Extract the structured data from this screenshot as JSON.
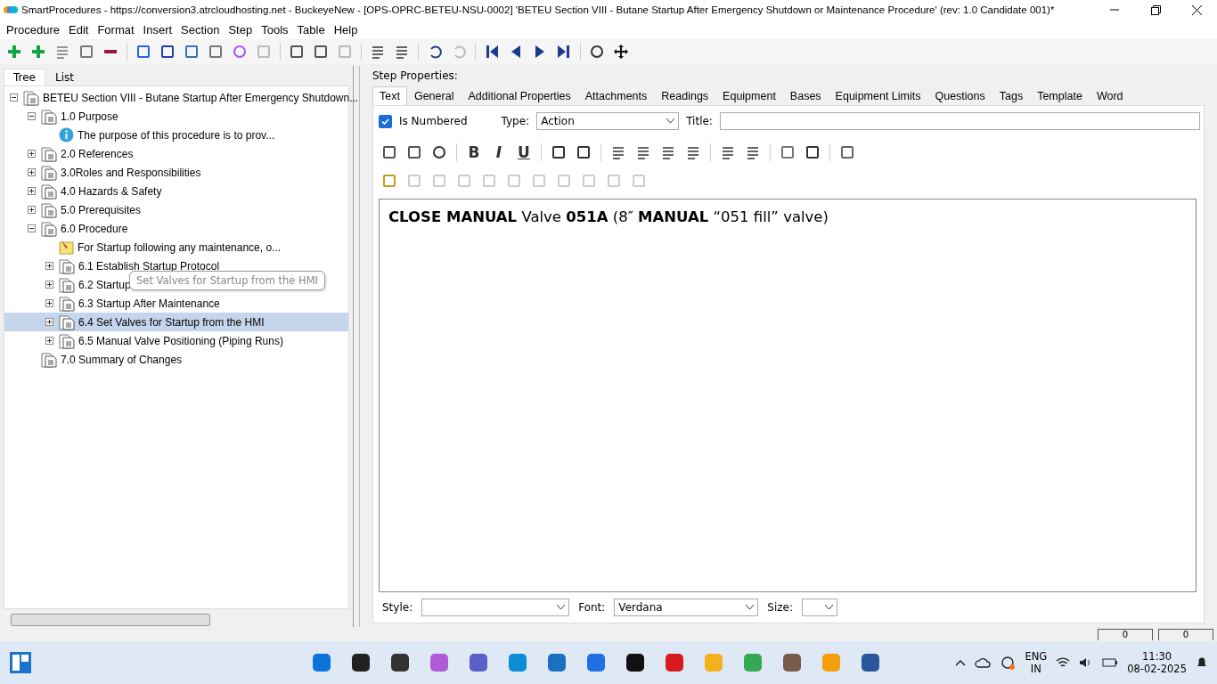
{
  "window": {
    "title": "SmartProcedures - https://conversion3.atrcloudhosting.net - BuckeyeNew - [OPS-OPRC-BETEU-NSU-0002] 'BETEU Section VIII - Butane Startup After Emergency Shutdown or Maintenance Procedure' (rev: 1.0 Candidate 001)*"
  },
  "menu": [
    "Procedure",
    "Edit",
    "Format",
    "Insert",
    "Section",
    "Step",
    "Tools",
    "Table",
    "Help"
  ],
  "left_tabs": [
    {
      "label": "Tree",
      "selected": true
    },
    {
      "label": "List",
      "selected": false
    }
  ],
  "tree": [
    {
      "label": "BETEU Section VIII - Butane Startup After Emergency Shutdown...",
      "kind": "doc",
      "expanded": true,
      "selected": false,
      "children": [
        {
          "label": "1.0 Purpose",
          "kind": "doc",
          "expanded": true,
          "selected": false,
          "children": [
            {
              "label": "The purpose of this procedure is to prov...",
              "kind": "info",
              "selected": false
            }
          ]
        },
        {
          "label": "2.0 References",
          "kind": "doc",
          "expanded": false,
          "selected": false
        },
        {
          "label": "3.0Roles and Responsibilities",
          "kind": "doc",
          "expanded": false,
          "selected": false
        },
        {
          "label": "4.0 Hazards & Safety",
          "kind": "doc",
          "expanded": false,
          "selected": false
        },
        {
          "label": "5.0 Prerequisites",
          "kind": "doc",
          "expanded": false,
          "selected": false
        },
        {
          "label": "6.0 Procedure",
          "kind": "doc",
          "expanded": true,
          "selected": false,
          "children": [
            {
              "label": "For Startup following any maintenance, o...",
              "kind": "note",
              "selected": false
            },
            {
              "label": "6.1 Establish Startup Protocol",
              "kind": "doc",
              "expanded": false,
              "selected": false
            },
            {
              "label": "6.2 Startup",
              "kind": "doc",
              "expanded": false,
              "selected": false
            },
            {
              "label": "6.3 Startup After Maintenance",
              "kind": "doc",
              "expanded": false,
              "selected": false
            },
            {
              "label": "6.4 Set Valves for Startup from the HMI",
              "kind": "doc",
              "expanded": false,
              "selected": true
            },
            {
              "label": "6.5 Manual Valve Positioning (Piping Runs)",
              "kind": "doc",
              "expanded": false,
              "selected": false
            }
          ]
        },
        {
          "label": "7.0 Summary of Changes",
          "kind": "doc",
          "selected": false
        }
      ]
    }
  ],
  "tooltip": "Set Valves for Startup from the HMI",
  "step_properties": {
    "heading": "Step Properties:",
    "tabs": [
      {
        "label": "Text",
        "selected": true
      },
      {
        "label": "General",
        "selected": false
      },
      {
        "label": "Additional Properties",
        "selected": false
      },
      {
        "label": "Attachments",
        "selected": false
      },
      {
        "label": "Readings",
        "selected": false
      },
      {
        "label": "Equipment",
        "selected": false
      },
      {
        "label": "Bases",
        "selected": false
      },
      {
        "label": "Equipment Limits",
        "selected": false
      },
      {
        "label": "Questions",
        "selected": false
      },
      {
        "label": "Tags",
        "selected": false
      },
      {
        "label": "Template",
        "selected": false
      },
      {
        "label": "Word",
        "selected": false
      }
    ],
    "is_numbered": {
      "label": "Is Numbered",
      "checked": true
    },
    "type": {
      "label": "Type:",
      "value": "Action"
    },
    "title": {
      "label": "Title:"
    },
    "format_buttons": [
      "B",
      "I",
      "U"
    ],
    "editor_text": "**CLOSE MANUAL** Valve **051A** (8″ **MANUAL** “051 fill” valve)",
    "style": {
      "label": "Style:"
    },
    "font": {
      "label": "Font:",
      "value": "Verdana"
    },
    "size": {
      "label": "Size:"
    }
  },
  "status_fields": [
    "0",
    "0"
  ],
  "taskbar": {
    "language": "ENG",
    "region": "IN",
    "time": "11:30",
    "date": "08-02-2025"
  }
}
